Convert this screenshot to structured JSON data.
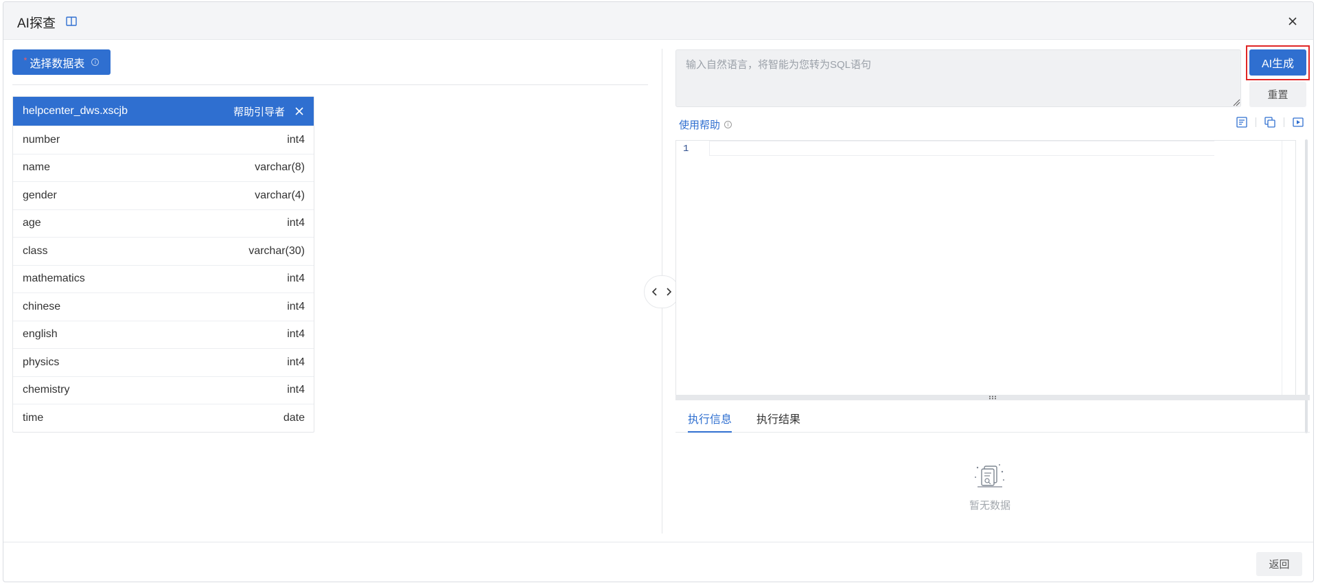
{
  "dialog": {
    "title": "AI探查",
    "back_label": "返回"
  },
  "left": {
    "select_table_label": "选择数据表",
    "table": {
      "name": "helpcenter_dws.xscjb",
      "owner": "帮助引导者",
      "fields": [
        {
          "name": "number",
          "type": "int4"
        },
        {
          "name": "name",
          "type": "varchar(8)"
        },
        {
          "name": "gender",
          "type": "varchar(4)"
        },
        {
          "name": "age",
          "type": "int4"
        },
        {
          "name": "class",
          "type": "varchar(30)"
        },
        {
          "name": "mathematics",
          "type": "int4"
        },
        {
          "name": "chinese",
          "type": "int4"
        },
        {
          "name": "english",
          "type": "int4"
        },
        {
          "name": "physics",
          "type": "int4"
        },
        {
          "name": "chemistry",
          "type": "int4"
        },
        {
          "name": "time",
          "type": "date"
        }
      ]
    }
  },
  "right": {
    "nl_placeholder": "输入自然语言，将智能为您转为SQL语句",
    "ai_generate_label": "AI生成",
    "reset_label": "重置",
    "help_label": "使用帮助",
    "editor": {
      "line_number": "1"
    },
    "tabs": [
      {
        "label": "执行信息",
        "active": true
      },
      {
        "label": "执行结果",
        "active": false
      }
    ],
    "empty_text": "暂无数据"
  },
  "colors": {
    "primary": "#2f6fd0",
    "highlight_frame": "#e02424"
  }
}
